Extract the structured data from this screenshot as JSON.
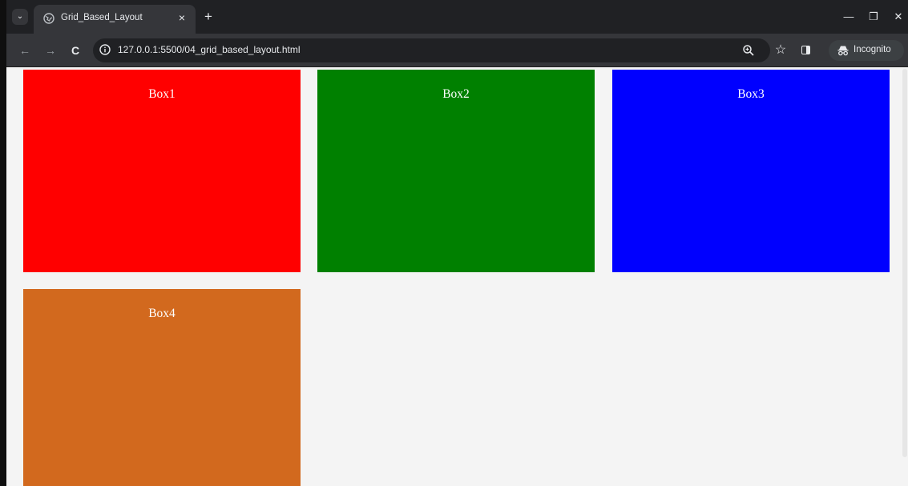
{
  "browser": {
    "tab": {
      "title": "Grid_Based_Layout",
      "close_glyph": "×",
      "favicon": "globe-icon"
    },
    "new_tab_glyph": "+",
    "tab_list_glyph": "⌄",
    "window_controls": {
      "minimize": "—",
      "restore": "❐",
      "close": "✕"
    },
    "toolbar": {
      "back_glyph": "←",
      "forward_glyph": "→",
      "reload_glyph": "C",
      "url": "127.0.0.1:5500/04_grid_based_layout.html",
      "zoom_icon": "zoom-in-icon",
      "bookmark_glyph": "☆",
      "side_panel_icon": "side-panel-icon",
      "incognito_label": "Incognito",
      "menu_glyph": "⋮"
    }
  },
  "page": {
    "background": "#f4f4f4",
    "boxes": [
      {
        "label": "Box1",
        "color": "#ff0000"
      },
      {
        "label": "Box2",
        "color": "#008000"
      },
      {
        "label": "Box3",
        "color": "#0000ff"
      },
      {
        "label": "Box4",
        "color": "#d2691e"
      }
    ]
  }
}
